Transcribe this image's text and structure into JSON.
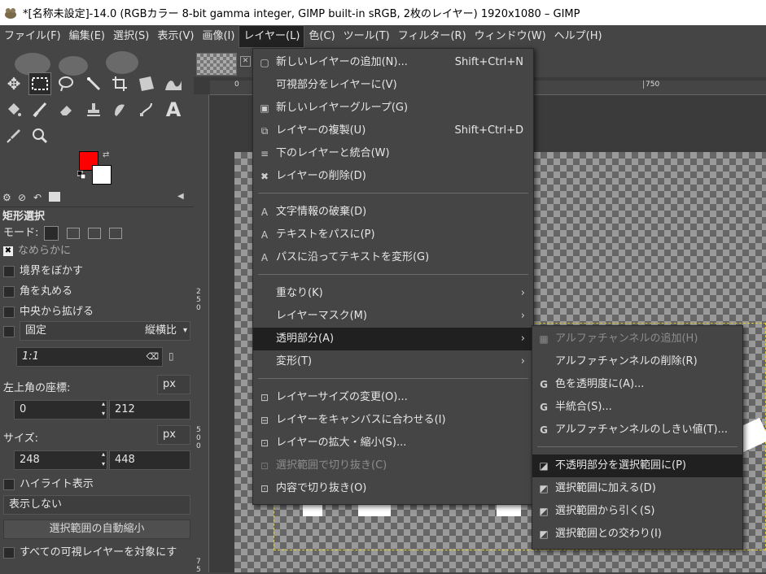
{
  "window": {
    "title": "*[名称未設定]-14.0 (RGBカラー 8-bit gamma integer, GIMP built-in sRGB, 2枚のレイヤー) 1920x1080 – GIMP"
  },
  "menubar": [
    {
      "label": "ファイル(F)"
    },
    {
      "label": "編集(E)"
    },
    {
      "label": "選択(S)"
    },
    {
      "label": "表示(V)"
    },
    {
      "label": "画像(I)"
    },
    {
      "label": "レイヤー(L)"
    },
    {
      "label": "色(C)"
    },
    {
      "label": "ツール(T)"
    },
    {
      "label": "フィルター(R)"
    },
    {
      "label": "ウィンドウ(W)"
    },
    {
      "label": "ヘルプ(H)"
    }
  ],
  "colors": {
    "foreground": "#ff0000",
    "background": "#ffffff",
    "selection": "#e0d030"
  },
  "tool_options": {
    "title": "矩形選択",
    "mode_label": "モード:",
    "antialias": "なめらかに",
    "feather": "境界をぼかす",
    "rounded": "角を丸める",
    "expand_center": "中央から拡げる",
    "fixed": "固定",
    "fixed_mode": "縦横比",
    "ratio": "1:1",
    "position_label": "左上角の座標:",
    "position_unit": "px",
    "pos_x": "0",
    "pos_y": "212",
    "size_label": "サイズ:",
    "size_unit": "px",
    "size_w": "248",
    "size_h": "448",
    "highlight": "ハイライト表示",
    "guides": "表示しない",
    "auto_shrink": "選択範囲の自動縮小",
    "all_layers": "すべての可視レイヤーを対象にす"
  },
  "rulers": {
    "top": [
      "0",
      "750"
    ],
    "left": [
      "2 5 0",
      "5 0 0",
      "7 5"
    ]
  },
  "layer_menu": [
    {
      "icon": "▢",
      "label": "新しいレイヤーの追加(N)...",
      "shortcut": "Shift+Ctrl+N"
    },
    {
      "icon": "",
      "label": "可視部分をレイヤーに(V)",
      "shortcut": ""
    },
    {
      "icon": "▣",
      "label": "新しいレイヤーグループ(G)",
      "shortcut": ""
    },
    {
      "icon": "⧉",
      "label": "レイヤーの複製(U)",
      "shortcut": "Shift+Ctrl+D"
    },
    {
      "icon": "≡",
      "label": "下のレイヤーと統合(W)",
      "shortcut": ""
    },
    {
      "icon": "✖",
      "label": "レイヤーの削除(D)",
      "shortcut": ""
    },
    {
      "icon": "A",
      "label": "文字情報の破棄(D)",
      "shortcut": ""
    },
    {
      "icon": "A",
      "label": "テキストをパスに(P)",
      "shortcut": ""
    },
    {
      "icon": "A",
      "label": "パスに沿ってテキストを変形(G)",
      "shortcut": ""
    },
    {
      "icon": "",
      "label": "重なり(K)",
      "shortcut": ""
    },
    {
      "icon": "",
      "label": "レイヤーマスク(M)",
      "shortcut": ""
    },
    {
      "icon": "",
      "label": "透明部分(A)",
      "shortcut": ""
    },
    {
      "icon": "",
      "label": "変形(T)",
      "shortcut": ""
    },
    {
      "icon": "⊡",
      "label": "レイヤーサイズの変更(O)...",
      "shortcut": ""
    },
    {
      "icon": "⊟",
      "label": "レイヤーをキャンバスに合わせる(I)",
      "shortcut": ""
    },
    {
      "icon": "⊡",
      "label": "レイヤーの拡大・縮小(S)...",
      "shortcut": ""
    },
    {
      "icon": "⊡",
      "label": "選択範囲で切り抜き(C)",
      "shortcut": ""
    },
    {
      "icon": "⊡",
      "label": "内容で切り抜き(O)",
      "shortcut": ""
    }
  ],
  "transparency_menu": [
    {
      "icon": "▦",
      "label": "アルファチャンネルの追加(H)"
    },
    {
      "icon": "",
      "label": "アルファチャンネルの削除(R)"
    },
    {
      "icon": "G",
      "label": "色を透明度に(A)..."
    },
    {
      "icon": "G",
      "label": "半統合(S)..."
    },
    {
      "icon": "G",
      "label": "アルファチャンネルのしきい値(T)..."
    },
    {
      "icon": "◪",
      "label": "不透明部分を選択範囲に(P)"
    },
    {
      "icon": "◩",
      "label": "選択範囲に加える(D)"
    },
    {
      "icon": "◩",
      "label": "選択範囲から引く(S)"
    },
    {
      "icon": "◩",
      "label": "選択範囲との交わり(I)"
    }
  ]
}
